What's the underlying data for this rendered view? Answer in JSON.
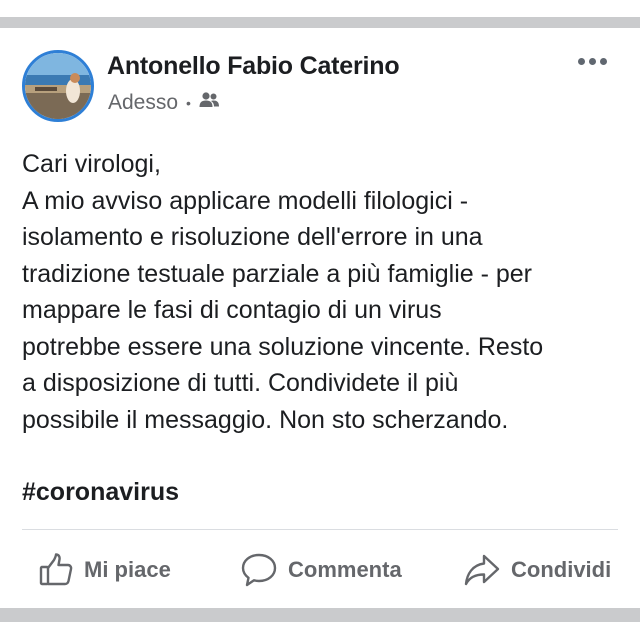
{
  "post": {
    "author_name": "Antonello Fabio Caterino",
    "timestamp": "Adesso",
    "separator": "•",
    "audience_icon": "friends-icon",
    "more_icon": "more-options-icon",
    "text": "Cari virologi,\nA mio avviso applicare modelli filologici -\nisolamento e risoluzione dell'errore in una\ntradizione testuale parziale a più famiglie - per\nmappare le fasi di contagio di un virus\npotrebbe essere una soluzione vincente. Resto\na disposizione di tutti. Condividete il più\npossibile il messaggio. Non sto scherzando.",
    "hashtag": "#coronavirus"
  },
  "actions": {
    "like_label": "Mi piace",
    "comment_label": "Commenta",
    "share_label": "Condividi"
  },
  "colors": {
    "text_primary": "#1c1e21",
    "text_secondary": "#65676b",
    "avatar_ring": "#2e7fd6",
    "divider": "#dadde1",
    "page_band": "#cacbcd"
  }
}
